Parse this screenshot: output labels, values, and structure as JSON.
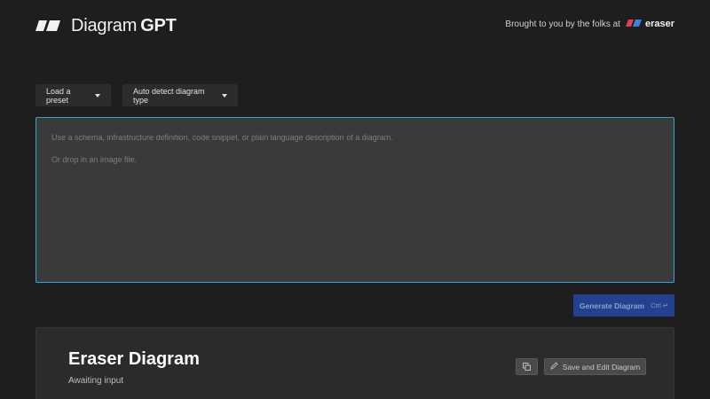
{
  "header": {
    "logo_icon": "diagramgpt-logo-icon",
    "title_light": "Diagram",
    "title_bold": "GPT",
    "credit_text": "Brought to you by the folks at",
    "credit_brand": "eraser",
    "credit_icon": "eraser-logo-icon"
  },
  "controls": {
    "preset_label": "Load a preset",
    "type_label": "Auto detect diagram type"
  },
  "input": {
    "placeholder_line1": "Use a schema, infrastructure definition, code snippet, or plain language description of a diagram.",
    "placeholder_line2": "Or drop in an image file."
  },
  "generate": {
    "label": "Generate Diagram",
    "shortcut": "Ctrl ↵"
  },
  "card": {
    "title": "Eraser Diagram",
    "status": "Awaiting input",
    "copy_icon": "copy-icon",
    "save_icon": "pencil-icon",
    "save_label": "Save and Edit Diagram"
  },
  "colors": {
    "background": "#1e1e1e",
    "accent_border": "#2ba9d6",
    "generate_button": "#23418f",
    "eraser_red": "#e0424b",
    "eraser_blue": "#3b82e8"
  }
}
